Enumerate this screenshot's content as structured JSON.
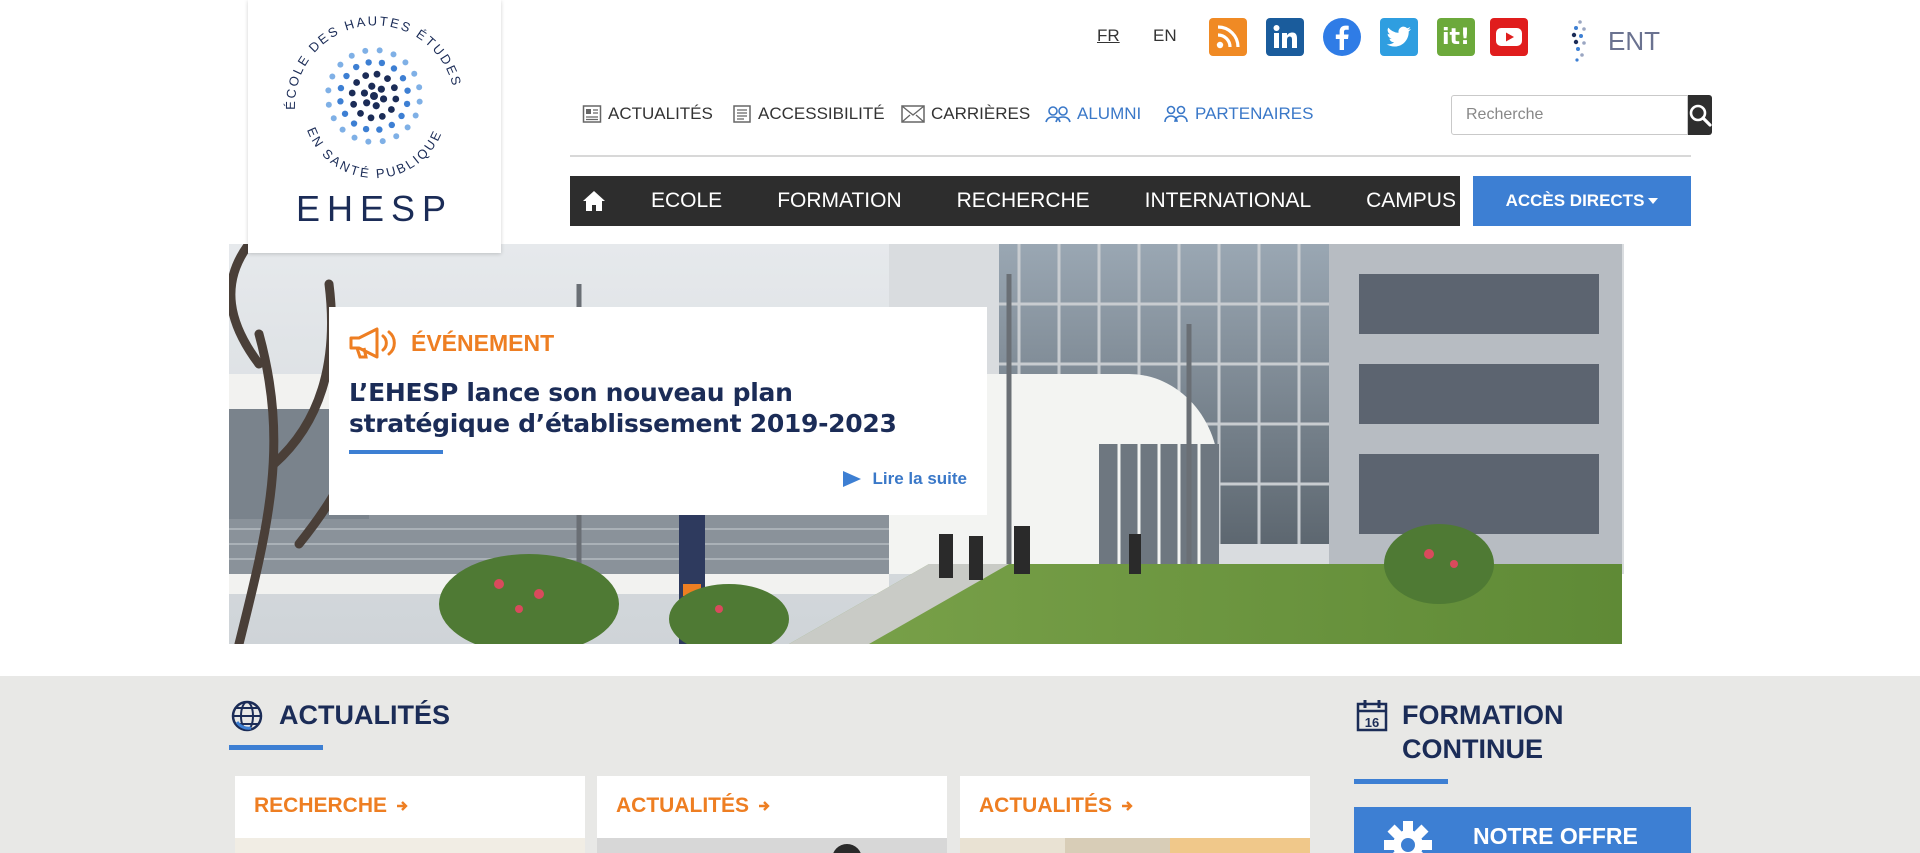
{
  "logo": {
    "text": "EHESP",
    "ring_text": "ÉCOLE DES HAUTES ÉTUDES EN SANTÉ PUBLIQUE"
  },
  "languages": {
    "fr": "FR",
    "en": "EN"
  },
  "social": [
    {
      "name": "rss-icon",
      "color": "#f08a24"
    },
    {
      "name": "linkedin-icon",
      "color": "#1a5c9c"
    },
    {
      "name": "facebook-icon",
      "color": "#2f7ce6"
    },
    {
      "name": "twitter-icon",
      "color": "#2f9ee0"
    },
    {
      "name": "scoopit-icon",
      "color": "#6ca93b"
    },
    {
      "name": "youtube-icon",
      "color": "#e01d1d"
    }
  ],
  "ent": {
    "label": "ENT"
  },
  "utility": {
    "actualites": "ACTUALITÉS",
    "accessibilite": "ACCESSIBILITÉ",
    "carrieres": "CARRIÈRES",
    "alumni": "ALUMNI",
    "partenaires": "PARTENAIRES"
  },
  "search": {
    "placeholder": "Recherche"
  },
  "nav": {
    "items": [
      "ECOLE",
      "FORMATION",
      "RECHERCHE",
      "INTERNATIONAL",
      "CAMPUS"
    ],
    "acces": "ACCÈS DIRECTS"
  },
  "hero": {
    "tag": "ÉVÉNEMENT",
    "title": "L’EHESP lance son nouveau plan stratégique d’établissement 2019-2023",
    "more": "Lire la suite"
  },
  "actualites": {
    "title": "ACTUALITÉS",
    "cards": [
      "RECHERCHE",
      "ACTUALITÉS",
      "ACTUALITÉS"
    ]
  },
  "formation": {
    "title": "FORMATION CONTINUE",
    "calendar_day": "16",
    "offre": "NOTRE OFFRE DE FORMATION"
  },
  "colors": {
    "accent": "#3d7fd3",
    "orange": "#ee7e22",
    "navy": "#1b2c57",
    "nav_bg": "#2d2d2d"
  }
}
